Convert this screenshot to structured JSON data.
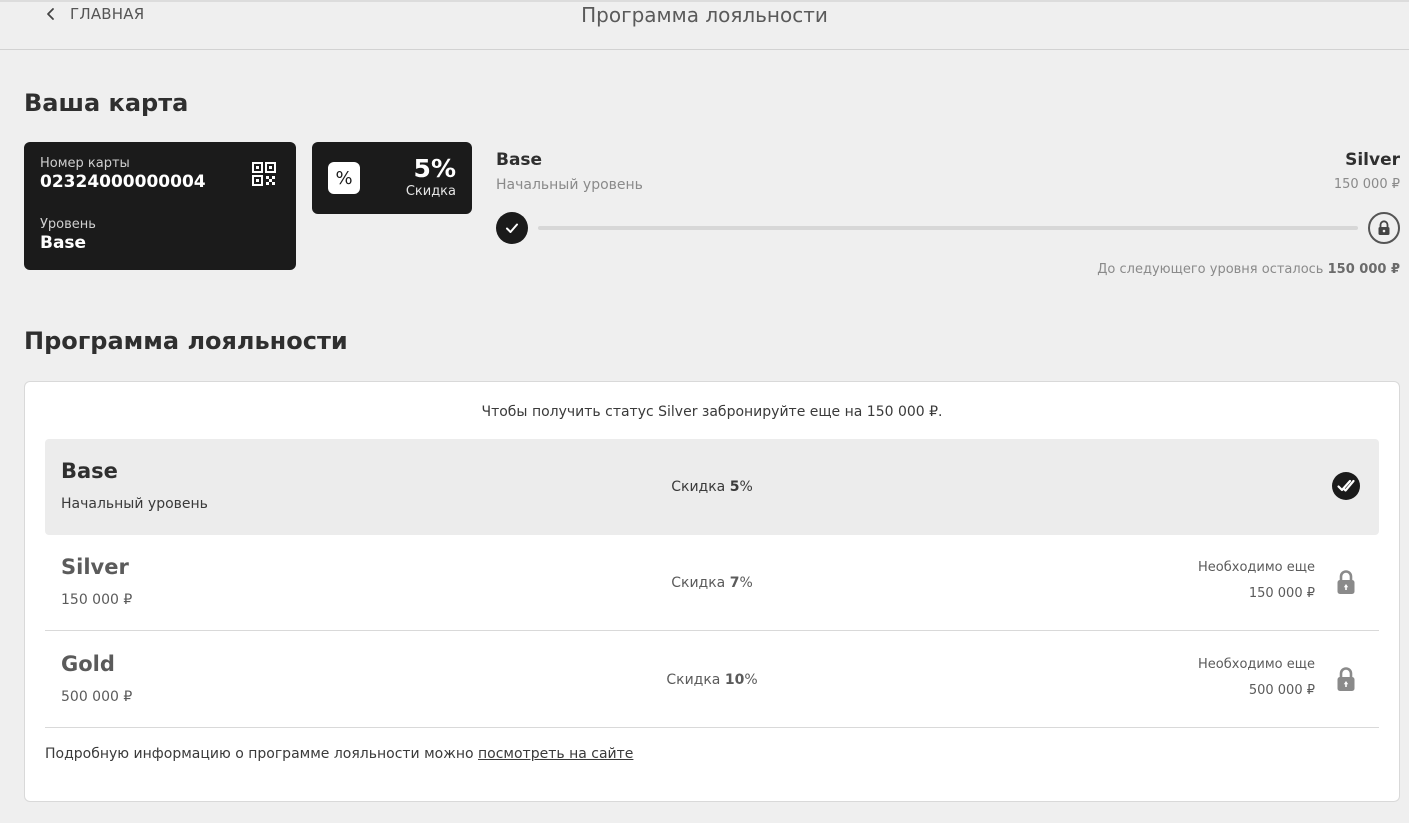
{
  "header": {
    "back_label": "ГЛАВНАЯ",
    "title": "Программа лояльности"
  },
  "card_section": {
    "title": "Ваша карта",
    "card": {
      "number_label": "Номер карты",
      "number": "02324000000004",
      "level_label": "Уровень",
      "level": "Base"
    },
    "discount": {
      "icon_symbol": "%",
      "value": "5%",
      "label": "Скидка"
    },
    "progress": {
      "current_name": "Base",
      "current_sub": "Начальный уровень",
      "next_name": "Silver",
      "next_amount": "150 000 ₽",
      "fraction": 0,
      "remaining_text": "До следующего уровня осталось",
      "remaining_value": "150 000 ₽"
    }
  },
  "program": {
    "title": "Программа лояльности",
    "hint": "Чтобы получить статус Silver забронируйте еще на 150 000 ₽.",
    "levels": [
      {
        "name": "Base",
        "sub": "Начальный уровень",
        "discount_label": "Скидка ",
        "discount_value": "5",
        "discount_unit": "%",
        "state": "active"
      },
      {
        "name": "Silver",
        "sub": "150 000 ₽",
        "discount_label": "Скидка ",
        "discount_value": "7",
        "discount_unit": "%",
        "need_label": "Необходимо еще",
        "need_value": "150 000 ₽",
        "state": "locked"
      },
      {
        "name": "Gold",
        "sub": "500 000 ₽",
        "discount_label": "Скидка ",
        "discount_value": "10",
        "discount_unit": "%",
        "need_label": "Необходимо еще",
        "need_value": "500 000 ₽",
        "state": "locked"
      }
    ],
    "footer_text": "Подробную информацию о программе лояльности можно ",
    "footer_link": "посмотреть на сайте"
  },
  "colors": {
    "background": "#efefef",
    "card_dark": "#1b1b1b",
    "panel": "#ffffff"
  }
}
